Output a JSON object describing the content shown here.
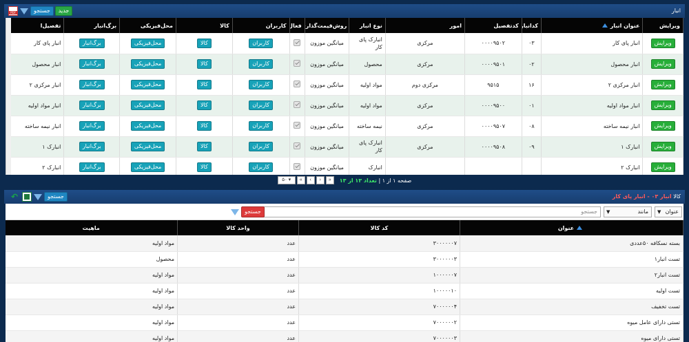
{
  "top": {
    "title": "انبار",
    "toolbar": {
      "new_label": "جدید",
      "search_label": "جستجو"
    },
    "columns": [
      "ویرایش",
      "عنوان انبار",
      "کدانبار",
      "کدتفصیل",
      "امور",
      "نوع انبار",
      "روش‌قیمت‌گذاری",
      "فعال",
      "کاربران",
      "کالا",
      "محل‌فیزیکی",
      "برگ‌انبار",
      "تفصیل‌ا"
    ],
    "buttons": {
      "edit": "ویرایش",
      "users": "کاربران",
      "goods": "کالا",
      "location": "محل‌فیزیکی",
      "sheet": "برگ‌انبار"
    },
    "rows": [
      {
        "title": "انبار پای کار",
        "code": "۰۳",
        "detail": "۰۰۰۰۹۵۰۲",
        "affairs": "مرکزی",
        "type": "انبارک پای کار",
        "pricing": "میانگین موزون",
        "active": true,
        "detail2": "انبار پای کار"
      },
      {
        "title": "انبار محصول",
        "code": "۰۲",
        "detail": "۰۰۰۰۹۵۰۱",
        "affairs": "مرکزی",
        "type": "محصول",
        "pricing": "میانگین موزون",
        "active": true,
        "detail2": "انبار محصول"
      },
      {
        "title": "انبار مرکزی ۲",
        "code": "۱۶",
        "detail": "۹۵۱۵",
        "affairs": "مرکزی دوم",
        "type": "مواد اولیه",
        "pricing": "میانگین موزون",
        "active": true,
        "detail2": "انبار مرکزی ۲"
      },
      {
        "title": "انبار مواد اولیه",
        "code": "۰۱",
        "detail": "۰۰۰۰۹۵۰۰",
        "affairs": "مرکزی",
        "type": "مواد اولیه",
        "pricing": "میانگین موزون",
        "active": true,
        "detail2": "انبار مواد اولیه"
      },
      {
        "title": "انبار نیمه ساخته",
        "code": "۰۸",
        "detail": "۰۰۰۰۹۵۰۷",
        "affairs": "مرکزی",
        "type": "نیمه ساخته",
        "pricing": "میانگین موزون",
        "active": true,
        "detail2": "انبار نیمه ساخته"
      },
      {
        "title": "انبارک ۱",
        "code": "۰۹",
        "detail": "۰۰۰۰۹۵۰۸",
        "affairs": "مرکزی",
        "type": "انبارک پای کار",
        "pricing": "میانگین موزون",
        "active": true,
        "detail2": "انبارک ۱"
      },
      {
        "title": "انبارک ۲",
        "code": "",
        "detail": "",
        "affairs": "",
        "type": "انبارک",
        "pricing": "میانگین موزون",
        "active": true,
        "detail2": "انبارک ۲"
      }
    ],
    "pager": {
      "page_size": "۵۰",
      "page_label": "صفحه ۱ از ۱",
      "count_label": "تعداد ۱۳ از ۱۳",
      "nav": {
        "first": "«",
        "prev": "‹",
        "next": "›",
        "last": "»"
      }
    }
  },
  "bottom": {
    "title_prefix": "کالا",
    "title_highlight": "انبار ۰۳ - انبار پای کار",
    "toolbar": {
      "search_label": "جستجو"
    },
    "filter": {
      "field": "عنوان",
      "operator": "مانند",
      "placeholder": "جستجو",
      "search_label": "جستجو"
    },
    "columns": [
      "عنوان",
      "کد کالا",
      "واحد کالا",
      "ماهیت"
    ],
    "rows": [
      {
        "title": "بسته نسکافه ۵۰عددی",
        "code": "۳۰۰۰۰۰۰۷",
        "unit": "عدد",
        "nature": "مواد اولیه"
      },
      {
        "title": "تست انبار۱",
        "code": "۳۰۰۰۰۰۰۳",
        "unit": "عدد",
        "nature": "محصول"
      },
      {
        "title": "تست انبار۲",
        "code": "۱۰۰۰۰۰۰۷",
        "unit": "عدد",
        "nature": "مواد اولیه"
      },
      {
        "title": "تست اولیه",
        "code": "۱۰۰۰۰۰۱۰",
        "unit": "عدد",
        "nature": "مواد اولیه"
      },
      {
        "title": "تست تخفیف",
        "code": "۷۰۰۰۰۰۰۴",
        "unit": "عدد",
        "nature": "مواد اولیه"
      },
      {
        "title": "تستی دارای عامل میوه",
        "code": "۷۰۰۰۰۰۰۲",
        "unit": "عدد",
        "nature": "مواد اولیه"
      },
      {
        "title": "تستی دارای میوه",
        "code": "۷۰۰۰۰۰۰۳",
        "unit": "عدد",
        "nature": "مواد اولیه"
      }
    ]
  }
}
